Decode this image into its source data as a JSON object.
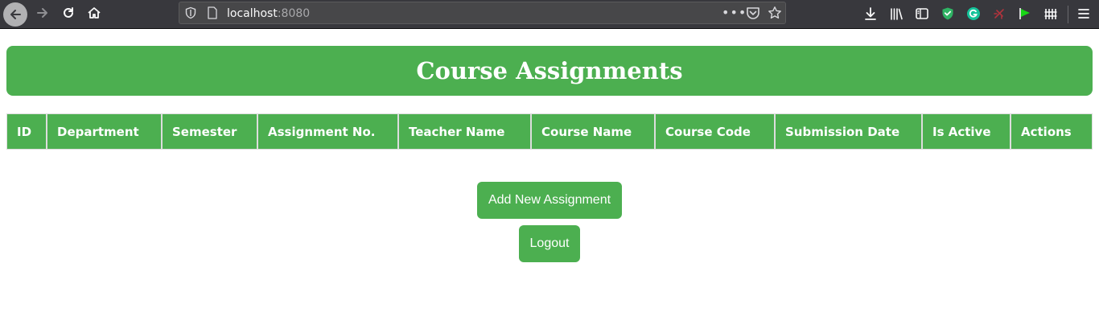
{
  "browser": {
    "url_host": "localhost",
    "url_port": ":8080"
  },
  "page": {
    "title": "Course Assignments",
    "table": {
      "columns": [
        "ID",
        "Department",
        "Semester",
        "Assignment No.",
        "Teacher Name",
        "Course Name",
        "Course Code",
        "Submission Date",
        "Is Active",
        "Actions"
      ],
      "rows": []
    },
    "buttons": {
      "add_label": "Add New Assignment",
      "logout_label": "Logout"
    }
  },
  "colors": {
    "accent": "#4caf50",
    "toolbar_bg": "#38383d"
  },
  "icons": {
    "toolbar_left": [
      "back-arrow-icon",
      "forward-arrow-icon",
      "reload-icon",
      "home-icon"
    ],
    "urlbar": [
      "tracking-shield-icon",
      "page-icon",
      "more-dots-icon",
      "pocket-icon",
      "bookmark-star-icon"
    ],
    "toolbar_right": [
      "downloads-icon",
      "library-icon",
      "sidebar-icon",
      "extension-shield-icon",
      "grammarly-icon",
      "extension-disabled-icon",
      "extension-flag-icon",
      "extension-fence-icon",
      "menu-icon"
    ]
  }
}
